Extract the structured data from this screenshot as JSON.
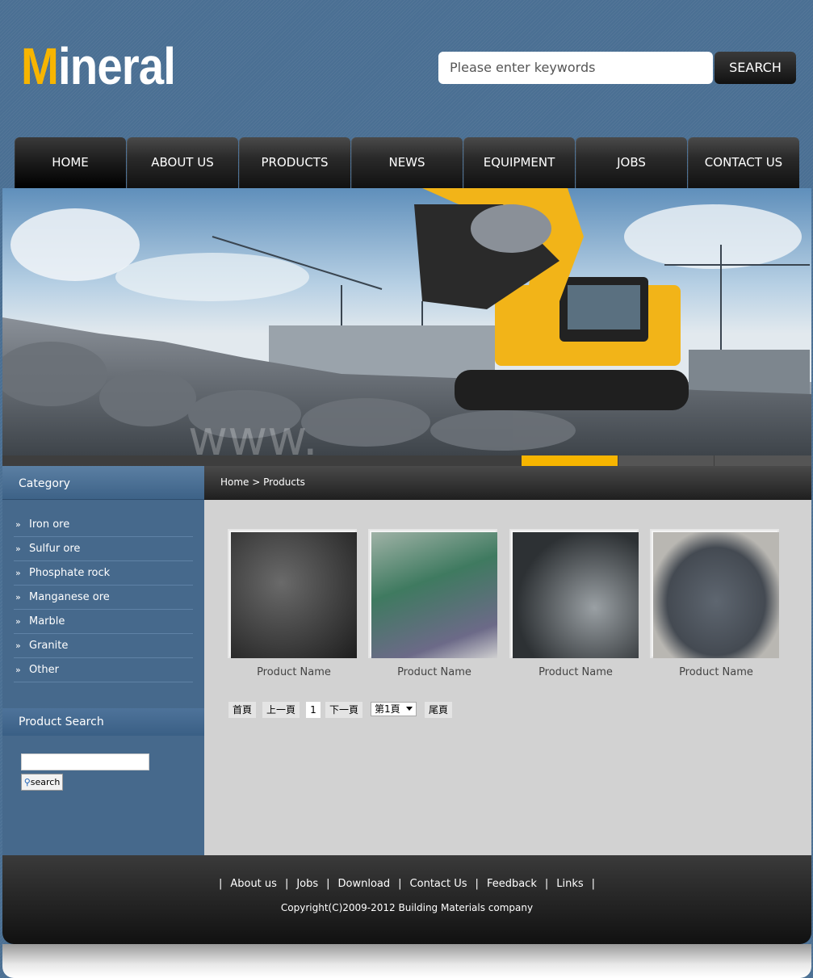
{
  "header": {
    "logo_first": "M",
    "logo_rest": "ineral",
    "search_placeholder": "Please enter keywords",
    "search_button": "SEARCH"
  },
  "nav": [
    "HOME",
    "ABOUT US",
    "PRODUCTS",
    "NEWS",
    "EQUIPMENT",
    "JOBS",
    "CONTACT US"
  ],
  "banner": {
    "watermark": "www."
  },
  "sidebar": {
    "category_title": "Category",
    "categories": [
      "Iron ore",
      "Sulfur ore",
      "Phosphate rock",
      "Manganese ore",
      "Marble",
      "Granite",
      "Other"
    ],
    "product_search_title": "Product Search",
    "search_button": "search"
  },
  "main": {
    "breadcrumb": "Home > Products",
    "products": [
      {
        "name": "Product Name",
        "color": "#3a3a3a"
      },
      {
        "name": "Product Name",
        "color": "#5f8c78"
      },
      {
        "name": "Product Name",
        "color": "#4a4e50"
      },
      {
        "name": "Product Name",
        "color": "#5a6066"
      }
    ],
    "pager": {
      "first": "首頁",
      "prev": "上一頁",
      "current": "1",
      "next": "下一頁",
      "select": "第1頁",
      "last": "尾頁"
    }
  },
  "footer": {
    "links": [
      "About us",
      "Jobs",
      "Download",
      "Contact Us",
      "Feedback",
      "Links"
    ],
    "copyright": "Copyright(C)2009-2012 Building Materials company"
  },
  "colors": {
    "accent": "#f7b500",
    "header_bg": "#4a6f93",
    "sidebar_bg": "#46698c",
    "content_bg": "#d2d2d2"
  }
}
